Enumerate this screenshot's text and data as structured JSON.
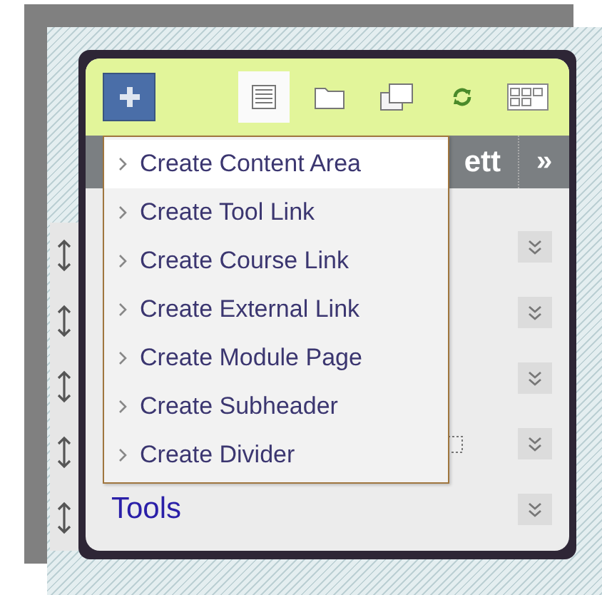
{
  "toolbar": {
    "add_button": {
      "kind": "add"
    },
    "icons": [
      {
        "kind": "list",
        "selected": true
      },
      {
        "kind": "folder",
        "selected": false
      },
      {
        "kind": "windows",
        "selected": false
      },
      {
        "kind": "refresh",
        "selected": false
      },
      {
        "kind": "grid",
        "selected": false
      }
    ]
  },
  "header_bar": {
    "title": "ett",
    "toggle": "»"
  },
  "rows": [
    {
      "kind": "blank"
    },
    {
      "kind": "blank"
    },
    {
      "kind": "blank"
    },
    {
      "kind": "icon"
    },
    {
      "kind": "link",
      "label": "Tools"
    }
  ],
  "menu": {
    "items": [
      {
        "label": "Create Content Area",
        "selected": true
      },
      {
        "label": "Create Tool Link",
        "selected": false
      },
      {
        "label": "Create Course Link",
        "selected": false
      },
      {
        "label": "Create External Link",
        "selected": false
      },
      {
        "label": "Create Module Page",
        "selected": false
      },
      {
        "label": "Create Subheader",
        "selected": false
      },
      {
        "label": "Create Divider",
        "selected": false
      }
    ]
  }
}
